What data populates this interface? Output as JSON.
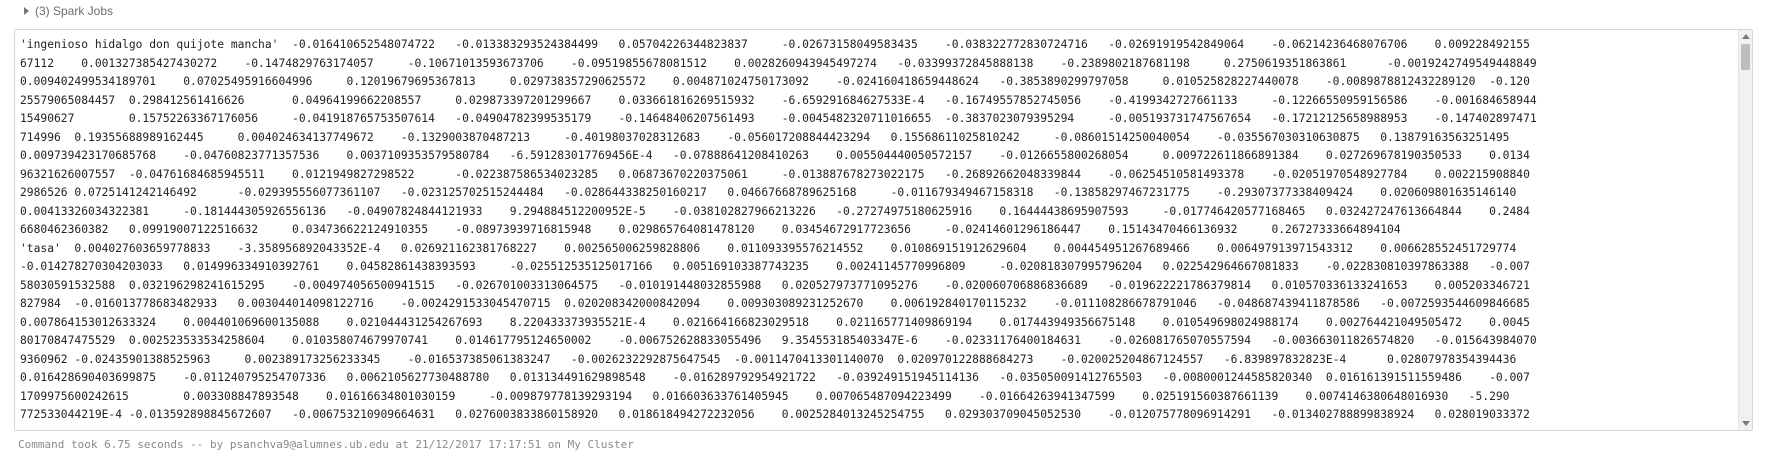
{
  "jobs": {
    "label": "(3) Spark Jobs"
  },
  "output": {
    "lines": [
      "'ingenioso hidalgo don quijote mancha'  -0.016410652548074722   -0.013383293524384499   0.05704226344823837     -0.02673158049583435    -0.038322772830724716   -0.02691919542849064    -0.06214236468076706    0.009228492155",
      "67112    0.001327385427430272    -0.1474829763174057     -0.10671013593673706    -0.09519855678081512    0.0028260943945497274   -0.03399372845888138    -0.2389802187681198     0.2750619351863861      -0.0019242749549448849",
      "0.009402499534189701    0.07025495916604996     0.12019679695367813     0.029738357290625572    0.004871024750173092    -0.024160418659448624   -0.3853890299797058     0.010525828227440078    -0.0089878812432289120  -0.120",
      "25579065084457  0.298412561416626       0.04964199662208557     0.029873397201299667    0.033661816269515932    -6.659291684627533E-4   -0.16749557852745056    -0.4199342727661133     -0.12266550959156586    -0.001684658944",
      "15490627        0.15752263367176056     -0.041918765753507614   -0.04904782399535179    -0.14648406207561493    -0.0045482320711016655  -0.3837023079395294     -0.005193731747567654   -0.17212125658988953    -0.147402897471",
      "714996  0.19355688989162445     0.004024634137749672    -0.1329003870487213     -0.40198037028312683    -0.056017208844423294   0.15568611025810242     -0.08601514250040054    -0.035567030310630875   0.13879163563251495",
      "0.009739423170685768    -0.04760823771357536    0.0037109353579580784   -6.591283017769456E-4   -0.07888641208410263    0.005504440050572157    -0.0126655800268054     0.009722611866891384    0.027269678190350533    0.0134",
      "96321626007557  -0.04761684685945511    0.0121949827298522      -0.022387586534023285   0.06873670220375061     -0.013887678273022175   -0.26892662048339844    -0.06254510581493378    -0.02051970548927784    0.002215908840",
      "2986526 0.0725141242146492      -0.029395556077361107   -0.023125702515244484   -0.028644338250160217   0.04667668789625168     -0.011679349467158318   -0.13858297467231775    -0.29307377338409424    0.020609801635146140",
      "0.00413326034322381     -0.181444305926556136   -0.04907824844121933    9.294884512200952E-5    -0.038102827966213226   -0.27274975180625916    0.16444438695907593     -0.017746420577168465   0.032427247613664844    0.2484",
      "6680462360382   0.09919007122516632     0.034736622124910355    -0.08973939716815948    0.029865764081478120    0.03454672917723656     -0.02414601296186447    0.15143470466136932     0.26727333664894104",
      "'tasa'  0.004027603659778833    -3.358956892043352E-4   0.026921162381768227    0.002565006259828806    0.011093395576214552    0.010869151912629604    0.004454951267689466    0.006497913971543312    0.006628552451729774",
      "-0.014278270304203033   0.014996334910392761    0.04582861438393593     -0.025512535125017166   0.005169103387743235    0.00241145770996809     -0.020818307995796204   0.022542964667081833    -0.022830810397863388   -0.007",
      "58030591532588  0.032196298241615295    -0.004974056500941515   -0.026701003313064575   -0.010191448032855988   0.020527973771095276    -0.020060706886836689   -0.019622221786379814   0.010570336133241653    0.005203346721",
      "827984  -0.016013778683482933   0.003044014098122716    -0.0024291533045470715  0.020208342000842094    0.009303089231252670    0.006192840170115232    -0.011108286678791046   -0.048687439411878586   -0.0072593544609846685",
      "0.007864153012633324    0.004401069600135088    0.021044431254267693    8.220433373935521E-4    0.021664166823029518    0.021165771409869194    0.017443949356675148    0.010549698024988174    0.002764421049505472    0.0045",
      "80170847475529  0.002523533534258604    0.010358074679970741    0.014617795124650002    -0.006752628833055496   9.354553185403347E-6    -0.02331176400184631    -0.026081765070557594   -0.003663011826574820   -0.015643984070",
      "9360962 -0.02435901388525963     0.002389173256233345    -0.016537385061383247   -0.0026232292875647545  -0.0011470413301140070  0.020970122888684273    -0.020025204867124557   -6.839897832823E-4      0.02807978354394436",
      "0.016428690403699875    -0.011240795254707336   0.0062105627730488780   0.013134491629898548    -0.016289792954921722   -0.039249151945114136   -0.035050091412765503   -0.0080001244585820340  0.016161391511559486    -0.007",
      "1709975600242615        0.003308847893548    0.01616634801030159     -0.009879778139293194   0.016603633761405945    0.007065487094223499    -0.01664263941347599    0.025191560387661139    0.0074146380648016930   -5.290",
      "772533044219E-4 -0.013592898845672607   -0.006753210909664631   0.0276003833860158920   0.018618494272232056    0.0025284013245254755   0.029303709045052530    -0.012075778096914291   -0.013402788899838924   0.028019033372"
    ]
  },
  "status": {
    "text": "Command took 6.75 seconds -- by psanchva9@alumnes.ub.edu at 21/12/2017 17:17:51 on My Cluster"
  }
}
